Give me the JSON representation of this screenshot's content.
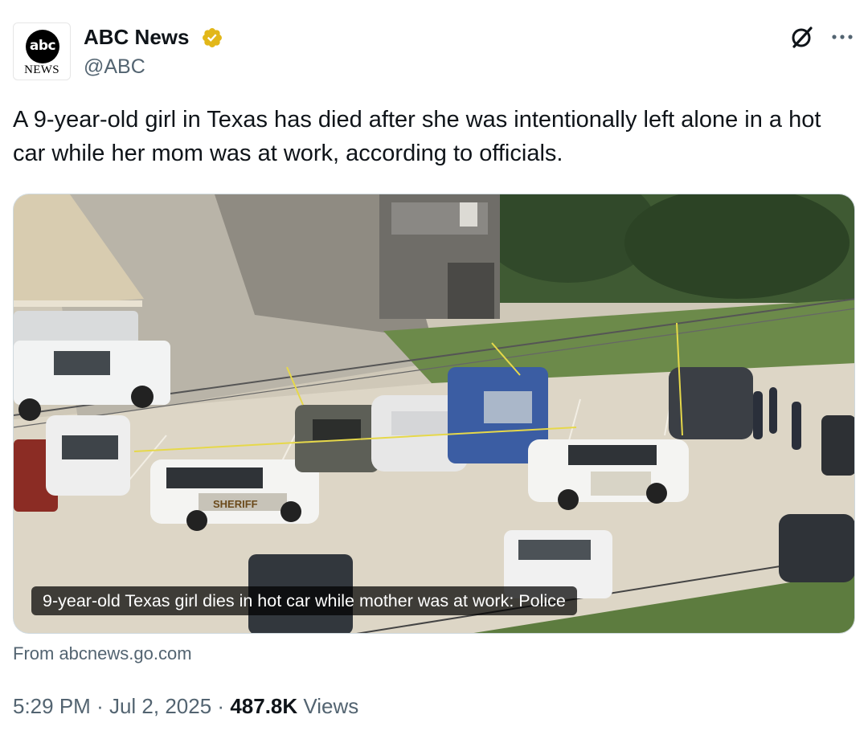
{
  "author": {
    "logo_text": "abc",
    "logo_subtext": "NEWS",
    "name": "ABC News",
    "handle": "@ABC"
  },
  "tweet": {
    "text": "A 9-year-old girl in Texas has died after she was intentionally left alone in a hot car while her mom was at work, according to officials."
  },
  "media": {
    "caption": "9-year-old Texas girl dies in hot car while mother was at work: Police",
    "source": "From abcnews.go.com",
    "vehicle_text": "SHERIFF"
  },
  "meta": {
    "time": "5:29 PM",
    "separator": "·",
    "date": "Jul 2, 2025",
    "views_count": "487.8K",
    "views_label": "Views"
  },
  "icons": {
    "verified": "verified-gold-badge-icon",
    "grok": "grok-icon",
    "more": "more-options-icon"
  },
  "colors": {
    "verified_gold": "#e2b719",
    "secondary_text": "#536471",
    "primary_text": "#0f1419"
  }
}
